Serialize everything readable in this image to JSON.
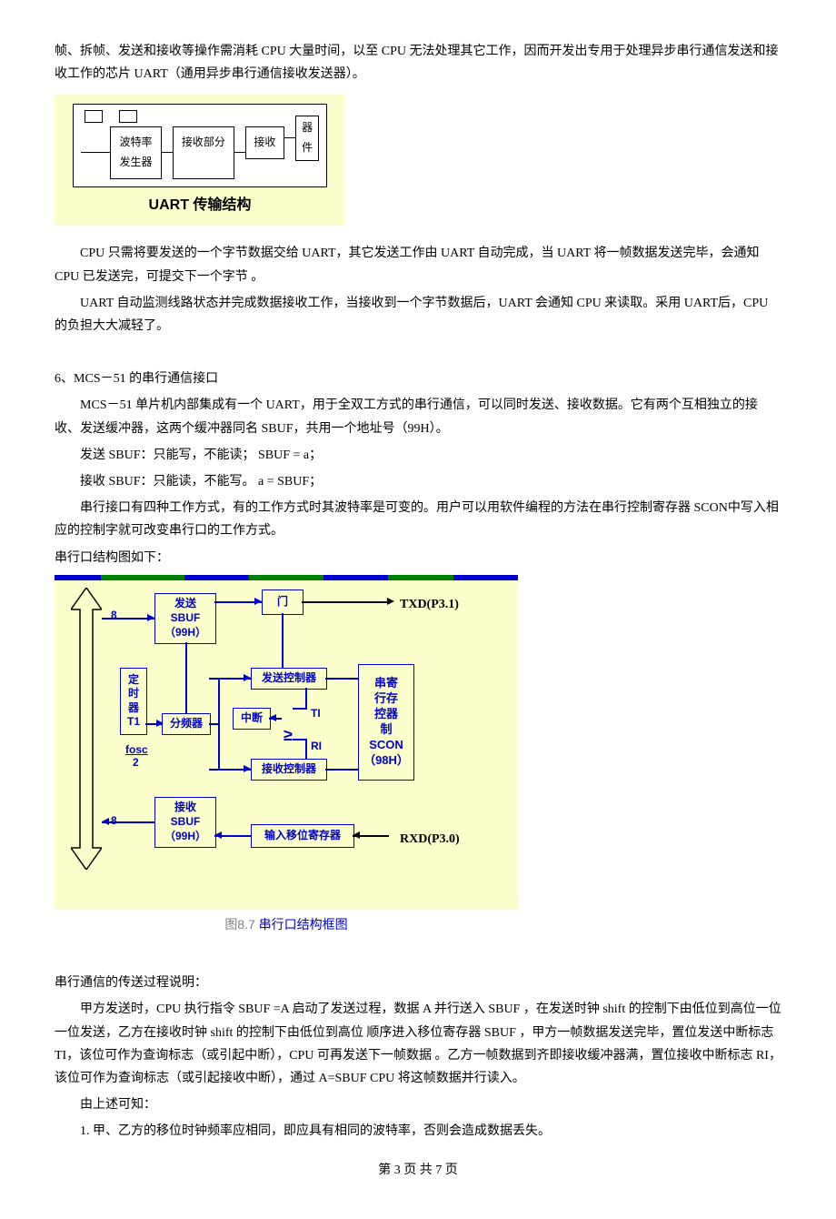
{
  "para": {
    "p1": "帧、拆帧、发送和接收等操作需消耗 CPU 大量时间，以至 CPU 无法处理其它工作，因而开发出专用于处理异步串行通信发送和接收工作的芯片 UART（通用异步串行通信接收发送器）。",
    "p2": "CPU 只需将要发送的一个字节数据交给 UART，其它发送工作由 UART 自动完成，当 UART 将一帧数据发送完毕，会通知 CPU  已发送完，可提交下一个字节 。",
    "p3": "UART 自动监测线路状态并完成数据接收工作，当接收到一个字节数据后，UART 会通知 CPU 来读取。采用 UART后，CPU 的负担大大减轻了。",
    "s6_title": "6、MCS－51 的串行通信接口",
    "s6_p1": "MCS－51 单片机内部集成有一个 UART，用于全双工方式的串行通信，可以同时发送、接收数据。它有两个互相独立的接收、发送缓冲器，这两个缓冲器同名 SBUF，共用一个地址号（99H）。",
    "s6_p2": "发送 SBUF：只能写，不能读；  SBUF = a；",
    "s6_p3": "接收 SBUF：只能读，不能写。  a = SBUF；",
    "s6_p4": "串行接口有四种工作方式，有的工作方式时其波特率是可变的。用户可以用软件编程的方法在串行控制寄存器 SCON中写入相应的控制字就可改变串行口的工作方式。",
    "s6_p5": "串行口结构图如下：",
    "trans_title": "串行通信的传送过程说明：",
    "trans_p1": "甲方发送时，CPU 执行指令  SBUF =A  启动了发送过程，数据 A 并行送入 SBUF ，在发送时钟 shift 的控制下由低位到高位一位一位发送，乙方在接收时钟 shift 的控制下由低位到高位 顺序进入移位寄存器 SBUF ，甲方一帧数据发送完毕，置位发送中断标志 TI，该位可作为查询标志（或引起中断），CPU 可再发送下一帧数据 。乙方一帧数据到齐即接收缓冲器满，置位接收中断标志 RI，该位可作为查询标志（或引起接收中断），通过 A=SBUF   CPU 将这帧数据并行读入。",
    "trans_p2": "由上述可知：",
    "trans_li1": "1.   甲、乙方的移位时钟频率应相同，即应具有相同的波特率，否则会造成数据丢失。"
  },
  "fig1": {
    "baud": "波特率\n发生器",
    "recv_part": "接收部分",
    "recv": "接收",
    "dev": "器件",
    "caption": "UART 传输结构"
  },
  "fig2": {
    "eight": "8",
    "send_sbuf": "发送\nSBUF\n（99H）",
    "gate": "门",
    "txd": "TXD(P3.1)",
    "timer": "定\n时\n器\nT1",
    "divider": "分频器",
    "interrupt": "中断",
    "ti": "TI",
    "ri": "RI",
    "ge": "≥",
    "send_ctrl": "发送控制器",
    "recv_ctrl": "接收控制器",
    "scon": "串寄\n行存\n控器\n制\nSCON\n（98H）",
    "fosc": "fosc",
    "fosc2": "2",
    "recv_sbuf": "接收\nSBUF\n（99H）",
    "shift_reg": "输入移位寄存器",
    "rxd": "RXD(P3.0)",
    "caption_a": "图8.7",
    "caption_b": " 串行口结构框图"
  },
  "footer": "第  3  页  共  7  页"
}
